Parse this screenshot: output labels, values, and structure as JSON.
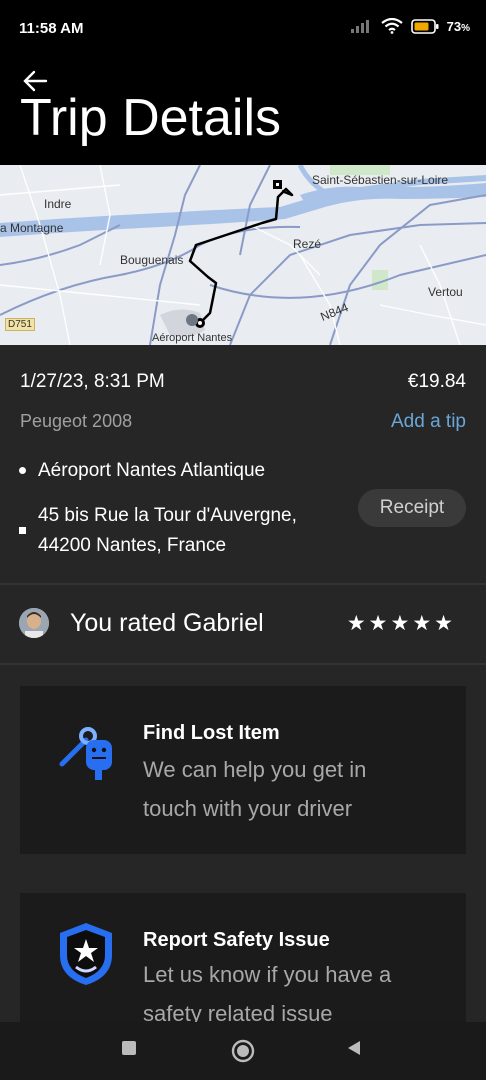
{
  "status_bar": {
    "time": "11:58 AM",
    "battery": "73"
  },
  "header": {
    "title": "Trip Details"
  },
  "map": {
    "labels": {
      "indre": "Indre",
      "montagne": "a Montagne",
      "saint_sebastien": "Saint-Sébastien-sur-Loire",
      "reze": "Rezé",
      "bouguenais": "Bouguenais",
      "vertou": "Vertou",
      "d751": "D751",
      "n844": "N844",
      "aeroport": "Aéroport Nantes"
    }
  },
  "trip": {
    "date": "1/27/23, 8:31 PM",
    "price": "€19.84",
    "vehicle": "Peugeot 2008",
    "add_tip": "Add a tip",
    "pickup": "Aéroport Nantes Atlantique",
    "dropoff_line1": "45 bis Rue la Tour d'Auvergne,",
    "dropoff_line2": "44200 Nantes, France",
    "receipt": "Receipt"
  },
  "rating": {
    "text": "You rated Gabriel",
    "stars": "★★★★★",
    "value": 5
  },
  "cards": {
    "lost": {
      "title": "Find Lost Item",
      "desc_line1": "We can help you get in",
      "desc_line2": "touch with your driver",
      "icon": "keys-icon"
    },
    "safety": {
      "title": "Report Safety Issue",
      "desc_line1": "Let us know if you have a",
      "desc_line2": "safety related issue",
      "icon": "shield-star-icon"
    }
  },
  "colors": {
    "accent": "#6aa7d8",
    "icon_blue": "#276ef1",
    "background": "#262626"
  }
}
